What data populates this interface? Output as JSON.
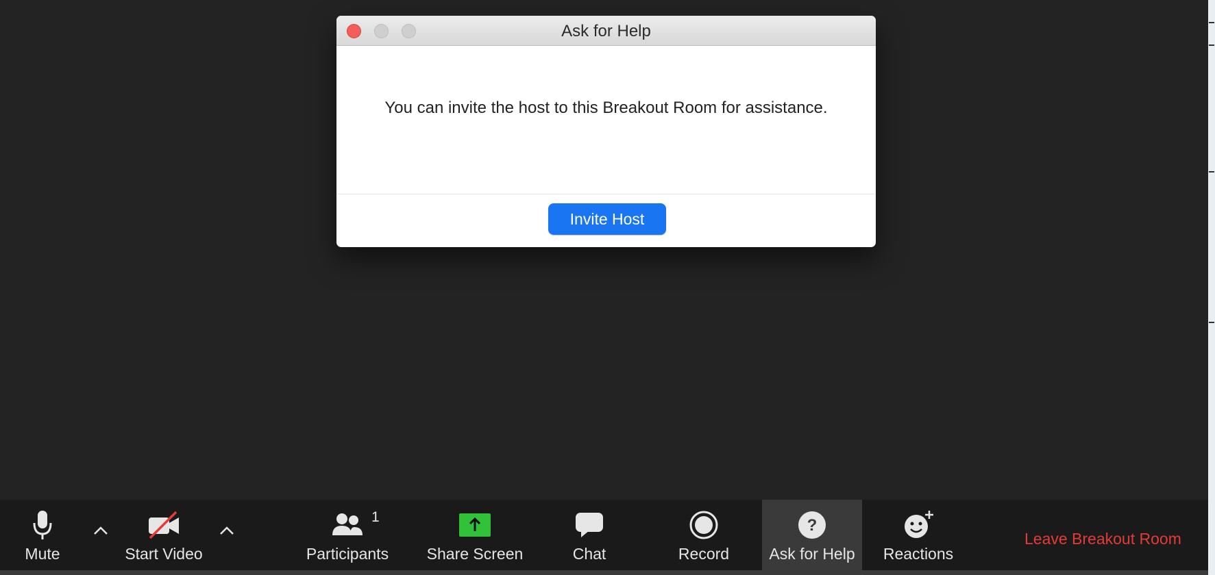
{
  "dialog": {
    "title": "Ask for Help",
    "message": "You can invite the host to this Breakout Room for assistance.",
    "invite_button": "Invite Host",
    "accent": "#1a75f2"
  },
  "toolbar": {
    "mute": {
      "label": "Mute",
      "icon": "microphone-icon"
    },
    "video": {
      "label": "Start Video",
      "icon": "video-off-icon"
    },
    "participants": {
      "label": "Participants",
      "count": "1",
      "icon": "participants-icon"
    },
    "share": {
      "label": "Share Screen",
      "icon": "share-screen-icon",
      "color": "#31c23a"
    },
    "chat": {
      "label": "Chat",
      "icon": "chat-icon"
    },
    "record": {
      "label": "Record",
      "icon": "record-icon"
    },
    "help": {
      "label": "Ask for Help",
      "icon": "help-icon"
    },
    "reactions": {
      "label": "Reactions",
      "icon": "reactions-icon"
    },
    "leave": {
      "label": "Leave Breakout Room",
      "color": "#e53b36"
    }
  }
}
